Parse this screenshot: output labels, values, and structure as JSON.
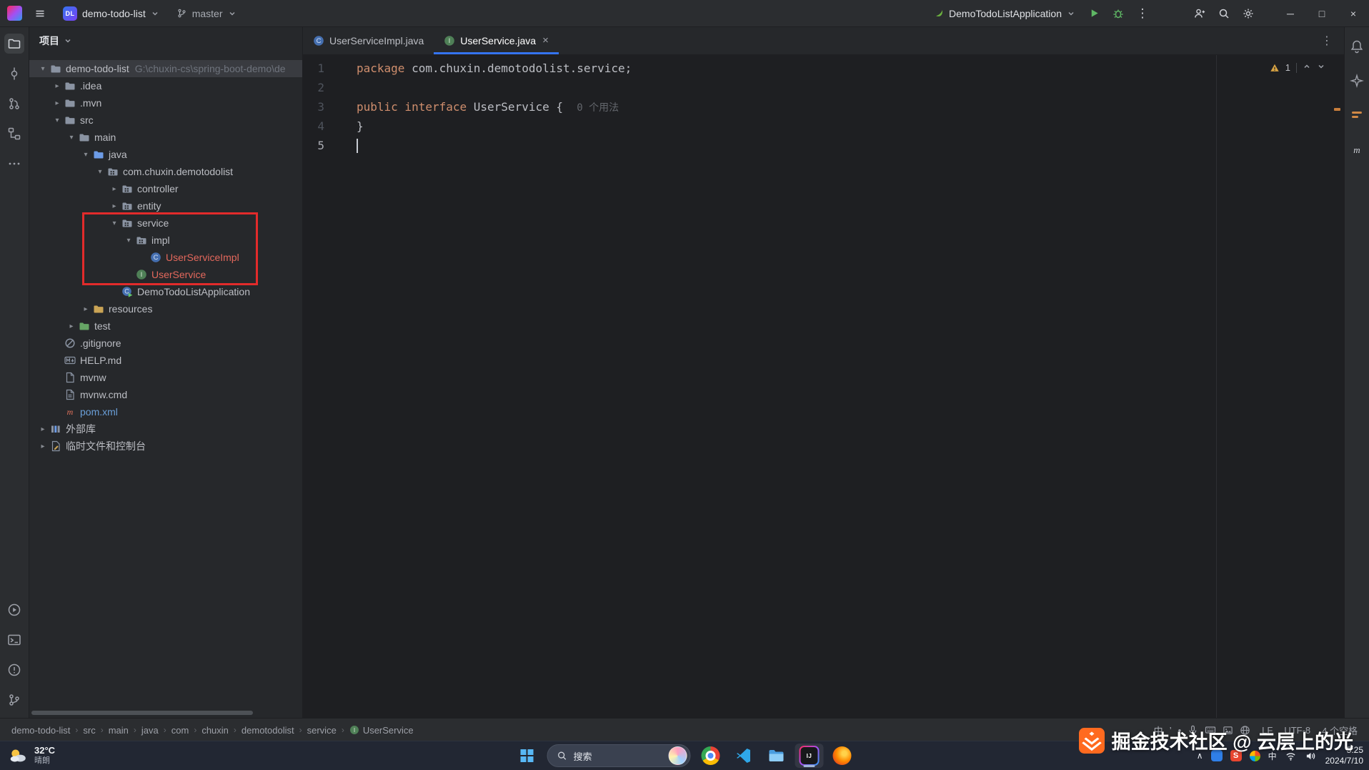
{
  "colors": {
    "accent_blue": "#3574f0",
    "annotation_red": "#e22b2b",
    "keyword_orange": "#cf8e6d",
    "vcs_untracked_red": "#e4685c",
    "vcs_modified_blue": "#6a9fd8",
    "spring_green": "#6db33f"
  },
  "title_bar": {
    "project_badge": "DL",
    "project_name": "demo-todo-list",
    "branch_name": "master",
    "run_config": "DemoTodoListApplication",
    "more_actions": "⋮",
    "minimize": "─",
    "maximize": "□",
    "close": "×"
  },
  "left_strip": {
    "top": [
      {
        "name": "project",
        "active": true
      },
      {
        "name": "commit"
      },
      {
        "name": "pull-requests"
      },
      {
        "name": "structure"
      },
      {
        "name": "more"
      }
    ],
    "bottom": [
      {
        "name": "run"
      },
      {
        "name": "terminal"
      },
      {
        "name": "problems"
      },
      {
        "name": "version-control"
      }
    ]
  },
  "right_strip": [
    {
      "name": "bell"
    },
    {
      "name": "ai"
    },
    {
      "name": "bookmarks"
    },
    {
      "name": "maven-tool"
    }
  ],
  "project_panel": {
    "title": "项目",
    "tree": [
      {
        "label": "demo-todo-list",
        "suffix": "G:\\chuxin-cs\\spring-boot-demo\\de",
        "level": 0,
        "chevron": "open",
        "icon": "folder",
        "selected": true
      },
      {
        "label": ".idea",
        "level": 1,
        "chevron": "closed",
        "icon": "folder"
      },
      {
        "label": ".mvn",
        "level": 1,
        "chevron": "closed",
        "icon": "folder"
      },
      {
        "label": "src",
        "level": 1,
        "chevron": "open",
        "icon": "folder"
      },
      {
        "label": "main",
        "level": 2,
        "chevron": "open",
        "icon": "folder"
      },
      {
        "label": "java",
        "level": 3,
        "chevron": "open",
        "icon": "folder-java"
      },
      {
        "label": "com.chuxin.demotodolist",
        "level": 4,
        "chevron": "open",
        "icon": "package"
      },
      {
        "label": "controller",
        "level": 5,
        "chevron": "closed",
        "icon": "package"
      },
      {
        "label": "entity",
        "level": 5,
        "chevron": "closed",
        "icon": "package"
      },
      {
        "label": "service",
        "level": 5,
        "chevron": "open",
        "icon": "package",
        "boxed": true
      },
      {
        "label": "impl",
        "level": 6,
        "chevron": "open",
        "icon": "package",
        "boxed": true
      },
      {
        "label": "UserServiceImpl",
        "level": 7,
        "icon": "class",
        "color": "#e4685c",
        "boxed": true
      },
      {
        "label": "UserService",
        "level": 6,
        "icon": "interface",
        "color": "#e4685c",
        "boxed": true
      },
      {
        "label": "DemoTodoListApplication",
        "level": 5,
        "icon": "class-run"
      },
      {
        "label": "resources",
        "level": 3,
        "chevron": "closed",
        "icon": "folder-resources"
      },
      {
        "label": "test",
        "level": 2,
        "chevron": "closed",
        "icon": "folder-test"
      },
      {
        "label": ".gitignore",
        "level": 1,
        "icon": "ignore"
      },
      {
        "label": "HELP.md",
        "level": 1,
        "icon": "markdown"
      },
      {
        "label": "mvnw",
        "level": 1,
        "icon": "file"
      },
      {
        "label": "mvnw.cmd",
        "level": 1,
        "icon": "file-cmd"
      },
      {
        "label": "pom.xml",
        "level": 1,
        "icon": "maven",
        "color": "#6a9fd8"
      },
      {
        "label": "外部库",
        "level": 0,
        "chevron": "closed",
        "icon": "library"
      },
      {
        "label": "临时文件和控制台",
        "level": 0,
        "chevron": "closed",
        "icon": "scratch"
      }
    ]
  },
  "editor": {
    "tabs": [
      {
        "label": "UserServiceImpl.java",
        "icon": "class",
        "active": false
      },
      {
        "label": "UserService.java",
        "icon": "interface",
        "active": true,
        "close": "×"
      }
    ],
    "tabs_more": "⋮",
    "code": [
      {
        "n": 1,
        "tokens": [
          {
            "t": "package ",
            "s": "kw"
          },
          {
            "t": "com.chuxin.demotodolist.service;",
            "s": "pl"
          }
        ]
      },
      {
        "n": 2,
        "tokens": []
      },
      {
        "n": 3,
        "tokens": [
          {
            "t": "public interface ",
            "s": "kw"
          },
          {
            "t": "UserService ",
            "s": "pl"
          },
          {
            "t": "{  ",
            "s": "pl"
          },
          {
            "t": "0 个用法",
            "s": "hint"
          }
        ]
      },
      {
        "n": 4,
        "tokens": [
          {
            "t": "}",
            "s": "pl"
          }
        ]
      },
      {
        "n": 5,
        "tokens": [],
        "caret": true
      }
    ],
    "inspection": {
      "warning_count": "1"
    }
  },
  "status_bar": {
    "breadcrumbs": [
      {
        "label": "demo-todo-list"
      },
      {
        "label": "src"
      },
      {
        "label": "main"
      },
      {
        "label": "java"
      },
      {
        "label": "com"
      },
      {
        "label": "chuxin"
      },
      {
        "label": "demotodolist"
      },
      {
        "label": "service"
      },
      {
        "label": "UserService",
        "icon": "interface"
      }
    ],
    "ime_icons": [
      {
        "name": "ime-zh",
        "text": "中"
      },
      {
        "name": "ime-apostrophe",
        "text": "’"
      },
      {
        "name": "ime-dot",
        "text": "•"
      },
      {
        "name": "mic"
      },
      {
        "name": "keyboard"
      },
      {
        "name": "image"
      },
      {
        "name": "globe"
      }
    ],
    "line_separator": "LF",
    "encoding": "UTF-8",
    "indent": "4 个空格"
  },
  "taskbar": {
    "weather": {
      "temperature": "32°C",
      "condition": "晴朗"
    },
    "search_text": "搜索",
    "apps": [
      {
        "name": "chrome"
      },
      {
        "name": "vscode"
      },
      {
        "name": "explorer"
      },
      {
        "name": "intellij",
        "active": true
      },
      {
        "name": "firefox"
      }
    ],
    "tray": {
      "icons": [
        {
          "name": "chevron-up",
          "text": "∧"
        },
        {
          "name": "blue-app"
        },
        {
          "name": "sogou"
        },
        {
          "name": "pinwheel"
        },
        {
          "name": "ime-zh",
          "text": "中"
        },
        {
          "name": "network"
        },
        {
          "name": "volume"
        }
      ],
      "time": "5:25",
      "date": "2024/7/10"
    }
  },
  "watermark": {
    "text": "掘金技术社区 @ 云层上的光"
  }
}
